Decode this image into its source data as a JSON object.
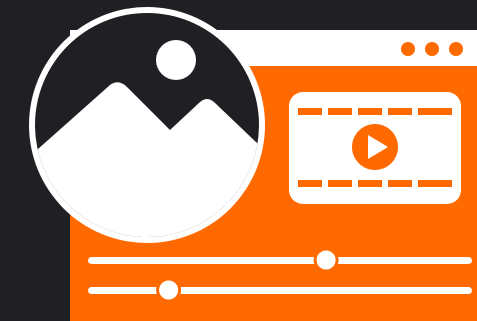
{
  "window": {
    "controls": [
      {
        "name": "window-dot-1"
      },
      {
        "name": "window-dot-2"
      },
      {
        "name": "window-dot-3"
      }
    ]
  },
  "image_icon": {
    "icon": "image-icon",
    "parts": [
      "sun",
      "mountains"
    ]
  },
  "video_card": {
    "icon": "play-icon"
  },
  "sliders": [
    {
      "name": "slider-top",
      "value": 0.62
    },
    {
      "name": "slider-bottom",
      "value": 0.21
    }
  ],
  "colors": {
    "background": "#1f1f24",
    "accent": "#ff6a00",
    "white": "#ffffff"
  }
}
